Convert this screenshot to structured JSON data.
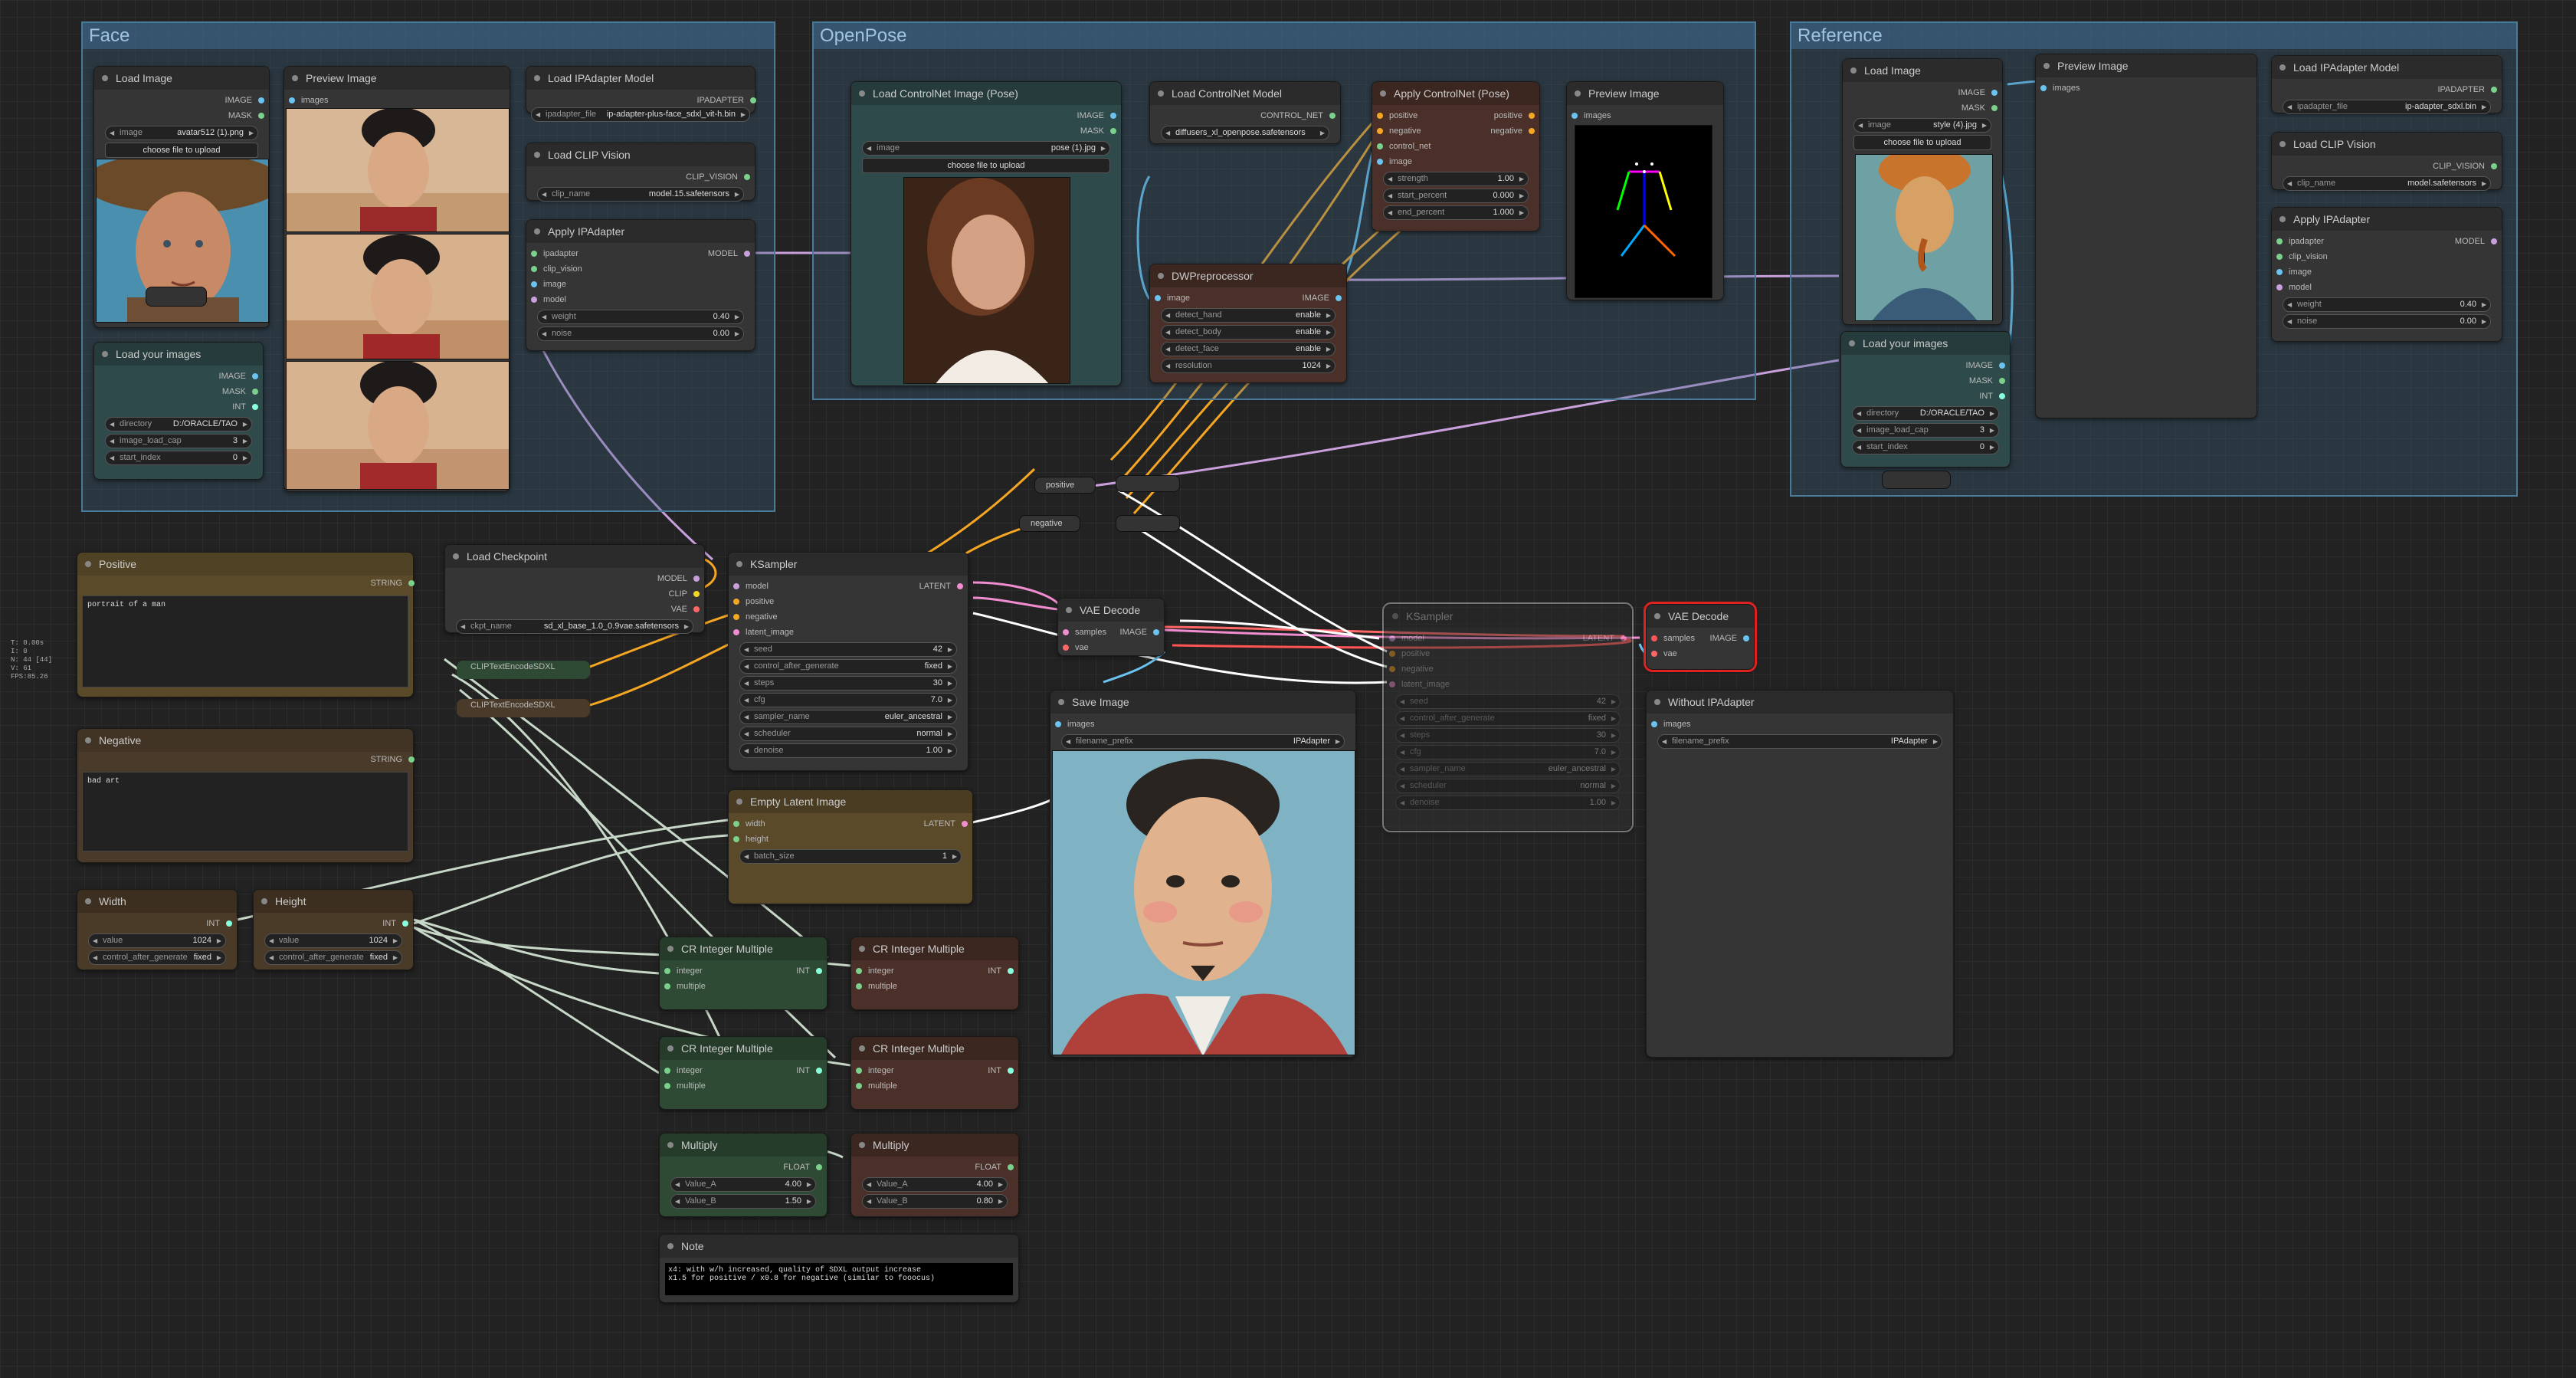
{
  "groups": {
    "face": "Face",
    "openpose": "OpenPose",
    "reference": "Reference"
  },
  "types": {
    "image": "IMAGE",
    "mask": "MASK",
    "int": "INT",
    "model": "MODEL",
    "ipadapter": "IPADAPTER",
    "clip_vision": "CLIP_VISION",
    "control_net": "CONTROL_NET",
    "string": "STRING",
    "clip": "CLIP",
    "vae": "VAE",
    "latent": "LATENT",
    "float": "FLOAT",
    "conditioning_pos": "positive",
    "conditioning_neg": "negative"
  },
  "ins": {
    "images": "images",
    "ipadapter": "ipadapter",
    "clip_vision": "clip_vision",
    "image": "image",
    "model": "model",
    "positive": "positive",
    "negative": "negative",
    "control_net": "control_net",
    "latent_image": "latent_image",
    "samples": "samples",
    "vae": "vae",
    "width": "width",
    "height": "height",
    "integer": "integer",
    "multiple": "multiple"
  },
  "face": {
    "load_image": {
      "title": "Load Image",
      "image": "avatar512 (1).png",
      "upload": "choose file to upload"
    },
    "preview": {
      "title": "Preview Image"
    },
    "load_ipadapter": {
      "title": "Load IPAdapter Model",
      "file": "ip-adapter-plus-face_sdxl_vit-h.bin"
    },
    "load_clip": {
      "title": "Load CLIP Vision",
      "clip_name": "model.15.safetensors"
    },
    "apply": {
      "title": "Apply IPAdapter",
      "weight": "0.40",
      "noise": "0.00"
    },
    "load_images": {
      "title": "Load your images",
      "directory": "D:/ORACLE/TAO",
      "image_load_cap": "3",
      "start_index": "0"
    }
  },
  "openpose": {
    "load_cn_image": {
      "title": "Load ControlNet Image (Pose)",
      "image": "pose (1).jpg",
      "upload": "choose file to upload"
    },
    "load_cn_model": {
      "title": "Load ControlNet Model",
      "file": "diffusers_xl_openpose.safetensors"
    },
    "apply_cn": {
      "title": "Apply ControlNet (Pose)",
      "strength": "1.00",
      "start_percent": "0.000",
      "end_percent": "1.000"
    },
    "preview": {
      "title": "Preview Image"
    },
    "dwp": {
      "title": "DWPreprocessor",
      "detect_hand": "enable",
      "detect_body": "enable",
      "detect_face": "enable",
      "resolution": "1024"
    }
  },
  "reference": {
    "load_image": {
      "title": "Load Image",
      "image": "style (4).jpg",
      "upload": "choose file to upload"
    },
    "preview": {
      "title": "Preview Image"
    },
    "load_ipadapter": {
      "title": "Load IPAdapter Model",
      "file": "ip-adapter_sdxl.bin"
    },
    "load_clip": {
      "title": "Load CLIP Vision",
      "clip_name": "model.safetensors"
    },
    "apply": {
      "title": "Apply IPAdapter",
      "weight": "0.40",
      "noise": "0.00"
    },
    "load_images": {
      "title": "Load your images",
      "directory": "D:/ORACLE/TAO",
      "image_load_cap": "3",
      "start_index": "0"
    }
  },
  "positive": {
    "title": "Positive",
    "text": "portrait of a man"
  },
  "negative": {
    "title": "Negative",
    "text": "bad art"
  },
  "width": {
    "title": "Width",
    "value": "1024",
    "control": "fixed"
  },
  "height": {
    "title": "Height",
    "value": "1024",
    "control": "fixed"
  },
  "checkpoint": {
    "title": "Load Checkpoint",
    "ckpt": "sd_xl_base_1.0_0.9vae.safetensors"
  },
  "clip_text1": "CLIPTextEncodeSDXL",
  "clip_text2": "CLIPTextEncodeSDXL",
  "ksampler": {
    "title": "KSampler",
    "seed": "42",
    "control_after_generate": "fixed",
    "steps": "30",
    "cfg": "7.0",
    "sampler_name": "euler_ancestral",
    "scheduler": "normal",
    "denoise": "1.00"
  },
  "ksampler2": {
    "title": "KSampler",
    "seed": "42",
    "control_after_generate": "fixed",
    "steps": "30",
    "cfg": "7.0",
    "sampler_name": "euler_ancestral",
    "scheduler": "normal",
    "denoise": "1.00"
  },
  "vae_decode": {
    "title": "VAE Decode"
  },
  "vae_decode2": {
    "title": "VAE Decode"
  },
  "save_image": {
    "title": "Save Image",
    "filename_prefix": "IPAdapter"
  },
  "without": {
    "title": "Without IPAdapter",
    "filename_prefix": "IPAdapter"
  },
  "empty_latent": {
    "title": "Empty Latent Image",
    "batch_size": "1"
  },
  "cr1": "CR Integer Multiple",
  "cr2": "CR Integer Multiple",
  "cr3": "CR Integer Multiple",
  "cr4": "CR Integer Multiple",
  "mult1": {
    "title": "Multiply",
    "value_a": "4.00",
    "value_b": "1.50"
  },
  "mult2": {
    "title": "Multiply",
    "value_a": "4.00",
    "value_b": "0.80"
  },
  "note": {
    "title": "Note",
    "text": "x4: with w/h increased, quality of SDXL output increase\nx1.5 for positive / x0.8 for negative (similar to fooocus)"
  },
  "reroutes": {
    "positive": "positive",
    "negative": "negative"
  },
  "labels": {
    "image": "image",
    "upload": "choose file to upload",
    "weight": "weight",
    "noise": "noise",
    "clip_name": "clip_name",
    "ipadapter_file": "ipadapter_file",
    "directory": "directory",
    "image_load_cap": "image_load_cap",
    "start_index": "start_index",
    "strength": "strength",
    "start_percent": "start_percent",
    "end_percent": "end_percent",
    "detect_hand": "detect_hand",
    "detect_body": "detect_body",
    "detect_face": "detect_face",
    "resolution": "resolution",
    "seed": "seed",
    "control_after_generate": "control_after_generate",
    "steps": "steps",
    "cfg": "cfg",
    "sampler_name": "sampler_name",
    "scheduler": "scheduler",
    "denoise": "denoise",
    "filename_prefix": "filename_prefix",
    "batch_size": "batch_size",
    "value": "value",
    "value_a": "Value_A",
    "value_b": "Value_B",
    "ckpt_name": "ckpt_name"
  },
  "stats": [
    "T: 0.00s",
    "I: 0",
    "N: 44 [44]",
    "V: 61",
    "FPS:85.26"
  ]
}
